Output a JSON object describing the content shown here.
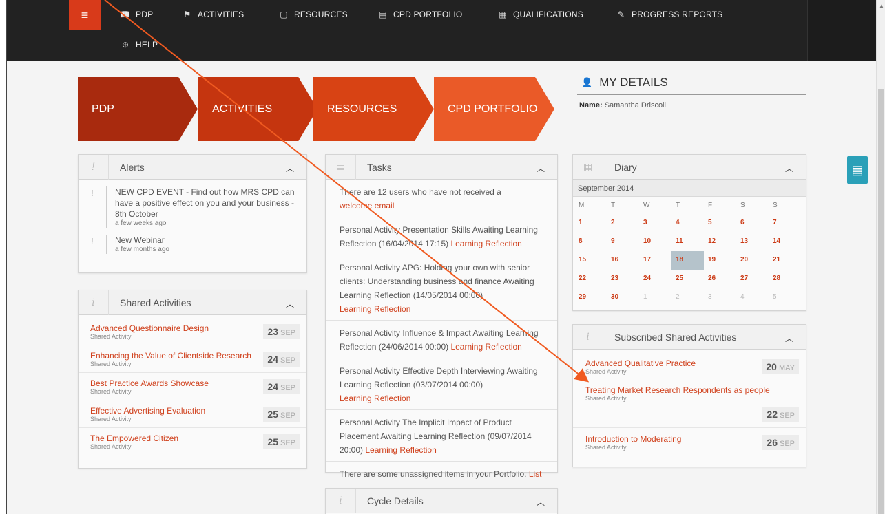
{
  "nav": {
    "items": [
      {
        "label": "PDP",
        "icon": "book-icon"
      },
      {
        "label": "ACTIVITIES",
        "icon": "flag-icon"
      },
      {
        "label": "RESOURCES",
        "icon": "folder-icon"
      },
      {
        "label": "CPD PORTFOLIO",
        "icon": "clipboard-icon"
      },
      {
        "label": "QUALIFICATIONS",
        "icon": "document-icon"
      },
      {
        "label": "PROGRESS REPORTS",
        "icon": "edit-icon"
      }
    ],
    "help_label": "HELP"
  },
  "breadcrumb": [
    "PDP",
    "ACTIVITIES",
    "RESOURCES",
    "CPD PORTFOLIO"
  ],
  "details": {
    "title": "MY DETAILS",
    "name_label": "Name:",
    "name_value": "Samantha Driscoll"
  },
  "alerts": {
    "title": "Alerts",
    "items": [
      {
        "text": "NEW CPD EVENT - Find out how MRS CPD can have a positive effect on you and your business - 8th October",
        "ago": "a few weeks ago"
      },
      {
        "text": "New Webinar",
        "ago": "a few months ago"
      }
    ]
  },
  "shared": {
    "title": "Shared Activities",
    "items": [
      {
        "title": "Advanced Questionnaire Design",
        "sub": "Shared Activity",
        "day": "23",
        "month": "SEP"
      },
      {
        "title": "Enhancing the Value of Clientside Research",
        "sub": "Shared Activity",
        "day": "24",
        "month": "SEP"
      },
      {
        "title": "Best Practice Awards Showcase",
        "sub": "Shared Activity",
        "day": "24",
        "month": "SEP"
      },
      {
        "title": "Effective Advertising Evaluation",
        "sub": "Shared Activity",
        "day": "25",
        "month": "SEP"
      },
      {
        "title": "The Empowered Citizen",
        "sub": "Shared Activity",
        "day": "25",
        "month": "SEP"
      }
    ]
  },
  "tasks": {
    "title": "Tasks",
    "items": [
      {
        "text": "There are 12 users who have not received a",
        "link": "welcome email"
      },
      {
        "text": "Personal Activity Presentation Skills Awaiting Learning Reflection (16/04/2014 17:15)",
        "link": "Learning Reflection"
      },
      {
        "text": "Personal Activity APG: Holding your own with senior clients: Understanding business and finance Awaiting Learning Reflection (14/05/2014 00:00)",
        "link": "Learning Reflection"
      },
      {
        "text": "Personal Activity Influence & Impact Awaiting Learning Reflection (24/06/2014 00:00)",
        "link": "Learning Reflection"
      },
      {
        "text": "Personal Activity Effective Depth Interviewing Awaiting Learning Reflection (03/07/2014 00:00)",
        "link": "Learning Reflection"
      },
      {
        "text": "Personal Activity The Implicit Impact of Product Placement Awaiting Learning Reflection (09/07/2014 20:00)",
        "link": "Learning Reflection"
      },
      {
        "text": "There are some unassigned items in your Portfolio.",
        "link": "List"
      }
    ]
  },
  "cycle": {
    "title": "Cycle Details"
  },
  "diary": {
    "title": "Diary",
    "month": "September 2014",
    "weekdays": [
      "M",
      "T",
      "W",
      "T",
      "F",
      "S",
      "S"
    ],
    "weeks": [
      [
        "1",
        "2",
        "3",
        "4",
        "5",
        "6",
        "7"
      ],
      [
        "8",
        "9",
        "10",
        "11",
        "12",
        "13",
        "14"
      ],
      [
        "15",
        "16",
        "17",
        "18",
        "19",
        "20",
        "21"
      ],
      [
        "22",
        "23",
        "24",
        "25",
        "26",
        "27",
        "28"
      ],
      [
        "29",
        "30",
        "1",
        "2",
        "3",
        "4",
        "5"
      ]
    ],
    "today": "18"
  },
  "subscribed": {
    "title": "Subscribed Shared Activities",
    "items": [
      {
        "title": "Advanced Qualitative Practice",
        "sub": "Shared Activity",
        "day": "20",
        "month": "MAY"
      },
      {
        "title": "Treating Market Research Respondents as people",
        "sub": "Shared Activity",
        "day": "22",
        "month": "SEP"
      },
      {
        "title": "Introduction to Moderating",
        "sub": "Shared Activity",
        "day": "26",
        "month": "SEP"
      }
    ]
  },
  "colors": {
    "accent": "#d0411d",
    "nav_bg": "#222222",
    "teal": "#2aa0b8"
  }
}
